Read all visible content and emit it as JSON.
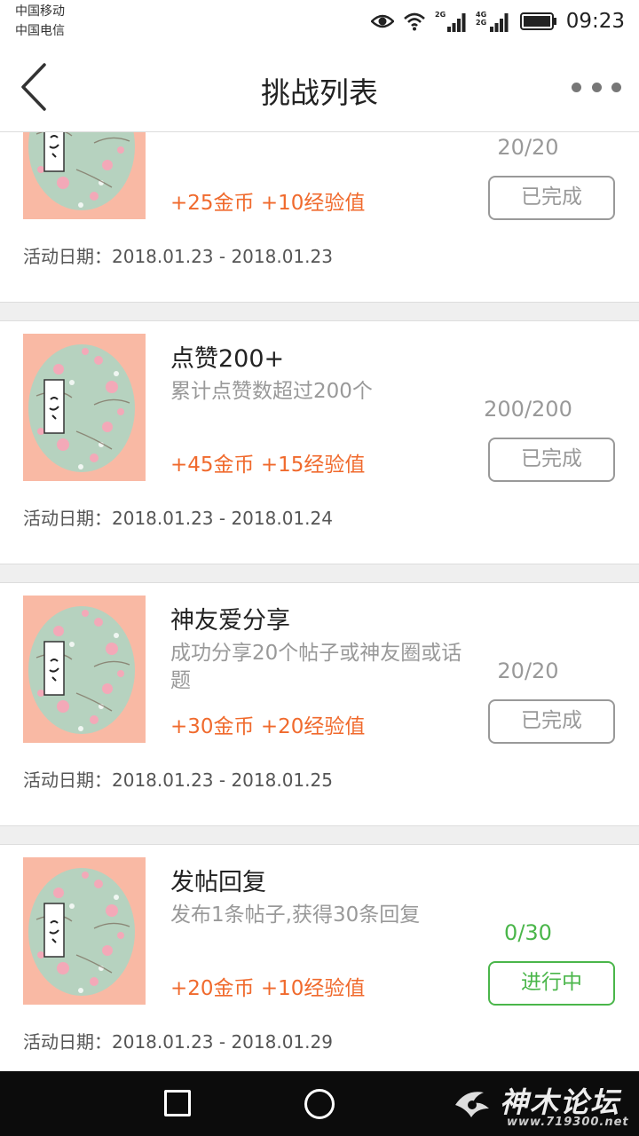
{
  "status_bar": {
    "carrier_1": "中国移动",
    "carrier_2": "中国电信",
    "net_1": "2G",
    "net_2a": "4G",
    "net_2b": "2G",
    "time": "09:23"
  },
  "header": {
    "title": "挑战列表",
    "back_icon": "chevron-left-icon",
    "more_icon": "more-dots-icon"
  },
  "challenges": [
    {
      "name": "",
      "desc": "",
      "reward": "+25金币 +10经验值",
      "progress": "20/20",
      "status": "已完成",
      "date_label": "活动日期：",
      "date_range": "2018.01.23 - 2018.01.23",
      "active": false,
      "badge_icon": "badge-seal-icon"
    },
    {
      "name": "点赞200+",
      "desc": "累计点赞数超过200个",
      "reward": "+45金币 +15经验值",
      "progress": "200/200",
      "status": "已完成",
      "date_label": "活动日期：",
      "date_range": "2018.01.23 - 2018.01.24",
      "active": false,
      "badge_icon": "badge-seal-icon"
    },
    {
      "name": "神友爱分享",
      "desc": "成功分享20个帖子或神友圈或话题",
      "reward": "+30金币 +20经验值",
      "progress": "20/20",
      "status": "已完成",
      "date_label": "活动日期：",
      "date_range": "2018.01.23 - 2018.01.25",
      "active": false,
      "badge_icon": "badge-seal-icon"
    },
    {
      "name": "发帖回复",
      "desc": "发布1条帖子,获得30条回复",
      "reward": "+20金币 +10经验值",
      "progress": "0/30",
      "status": "进行中",
      "date_label": "活动日期：",
      "date_range": "2018.01.23 - 2018.01.29",
      "active": true,
      "badge_icon": "badge-seal-icon"
    }
  ],
  "nav_bar": {
    "recent_icon": "square-recent-icon",
    "home_icon": "circle-home-icon",
    "watermark_text": "神木论坛",
    "watermark_url": "www.719300.net"
  },
  "colors": {
    "reward": "#f06a2d",
    "active": "#4ab64a",
    "done": "#999999",
    "thumb_bg": "#f9b9a4",
    "thumb_circle": "#b6d2bf"
  }
}
